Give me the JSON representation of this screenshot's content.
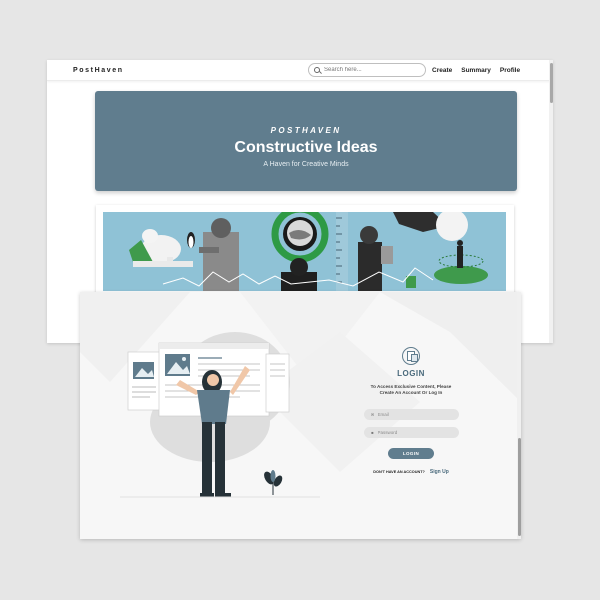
{
  "blog": {
    "brand": "PostHaven",
    "search": {
      "placeholder": "Search here..."
    },
    "nav": [
      "Create",
      "Summary",
      "Profile"
    ],
    "hero": {
      "kicker": "POSTHAVEN",
      "title": "Constructive Ideas",
      "subtitle": "A Haven for Creative Minds"
    }
  },
  "login": {
    "title": "LOGIN",
    "description": [
      "To Access Exclusive Content, Please",
      "Create An Account Or Log In"
    ],
    "email_placeholder": "Email",
    "password_placeholder": "Password",
    "button": "LOGIN",
    "signup_question": "DON'T HAVE AN ACCOUNT?",
    "signup_link": "Sign Up"
  },
  "colors": {
    "accent": "#607d8e",
    "hero_bg": "#607d8e",
    "collage_bg": "#8fc2d6"
  },
  "icons": [
    "search-icon",
    "mail-icon",
    "lock-icon",
    "logo-icon"
  ]
}
